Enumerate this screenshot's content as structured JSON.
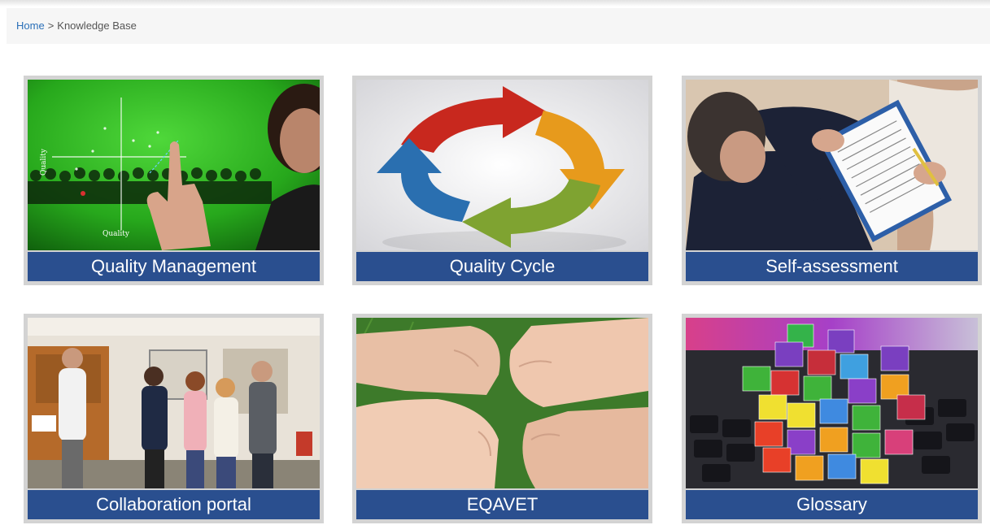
{
  "breadcrumb": {
    "home": "Home",
    "separator": ">",
    "current": "Knowledge Base"
  },
  "tiles": [
    {
      "label": "Quality Management",
      "icon": "quality-management-photo"
    },
    {
      "label": "Quality Cycle",
      "icon": "cycle-arrows-graphic"
    },
    {
      "label": "Self-assessment",
      "icon": "clipboard-photo"
    },
    {
      "label": "Collaboration portal",
      "icon": "classroom-photo"
    },
    {
      "label": "EQAVET",
      "icon": "linked-hands-photo"
    },
    {
      "label": "Glossary",
      "icon": "cubes-keyboard-photo"
    }
  ],
  "image_text": {
    "quality_axis": "Quality"
  },
  "colors": {
    "caption_bg": "#2a4f8f",
    "link": "#2a6fb8",
    "tile_border": "#d3d3d3"
  }
}
